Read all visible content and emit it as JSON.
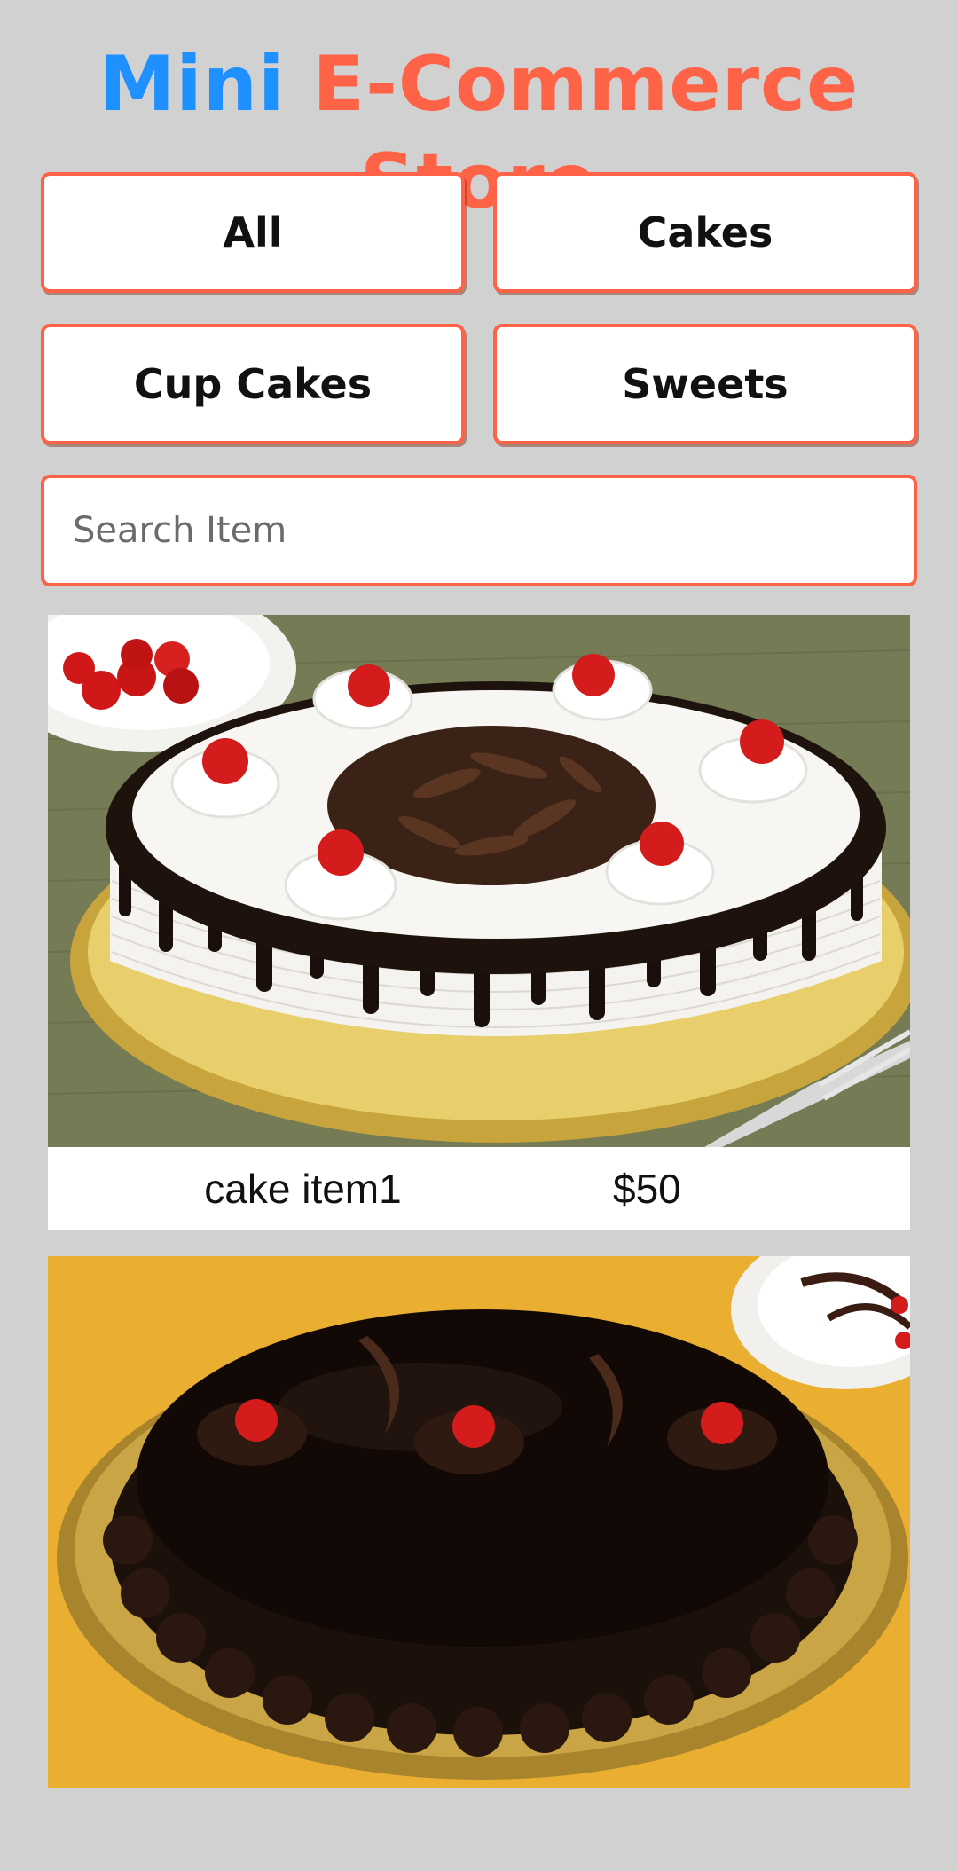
{
  "header": {
    "title_part1": "Mini",
    "title_part2": "E-Commerce Store"
  },
  "colors": {
    "background": "#d1d1d1",
    "accent_blue": "#1e90ff",
    "accent_orange": "#ff6347"
  },
  "filters": {
    "all": "All",
    "cakes": "Cakes",
    "cupcakes": "Cup Cakes",
    "sweets": "Sweets"
  },
  "search": {
    "placeholder": "Search Item",
    "value": ""
  },
  "products": [
    {
      "name": "cake item1",
      "price": "$50",
      "image": "black-forest-cake-photo"
    },
    {
      "name": "",
      "price": "",
      "image": "chocolate-truffle-cake-photo"
    }
  ]
}
